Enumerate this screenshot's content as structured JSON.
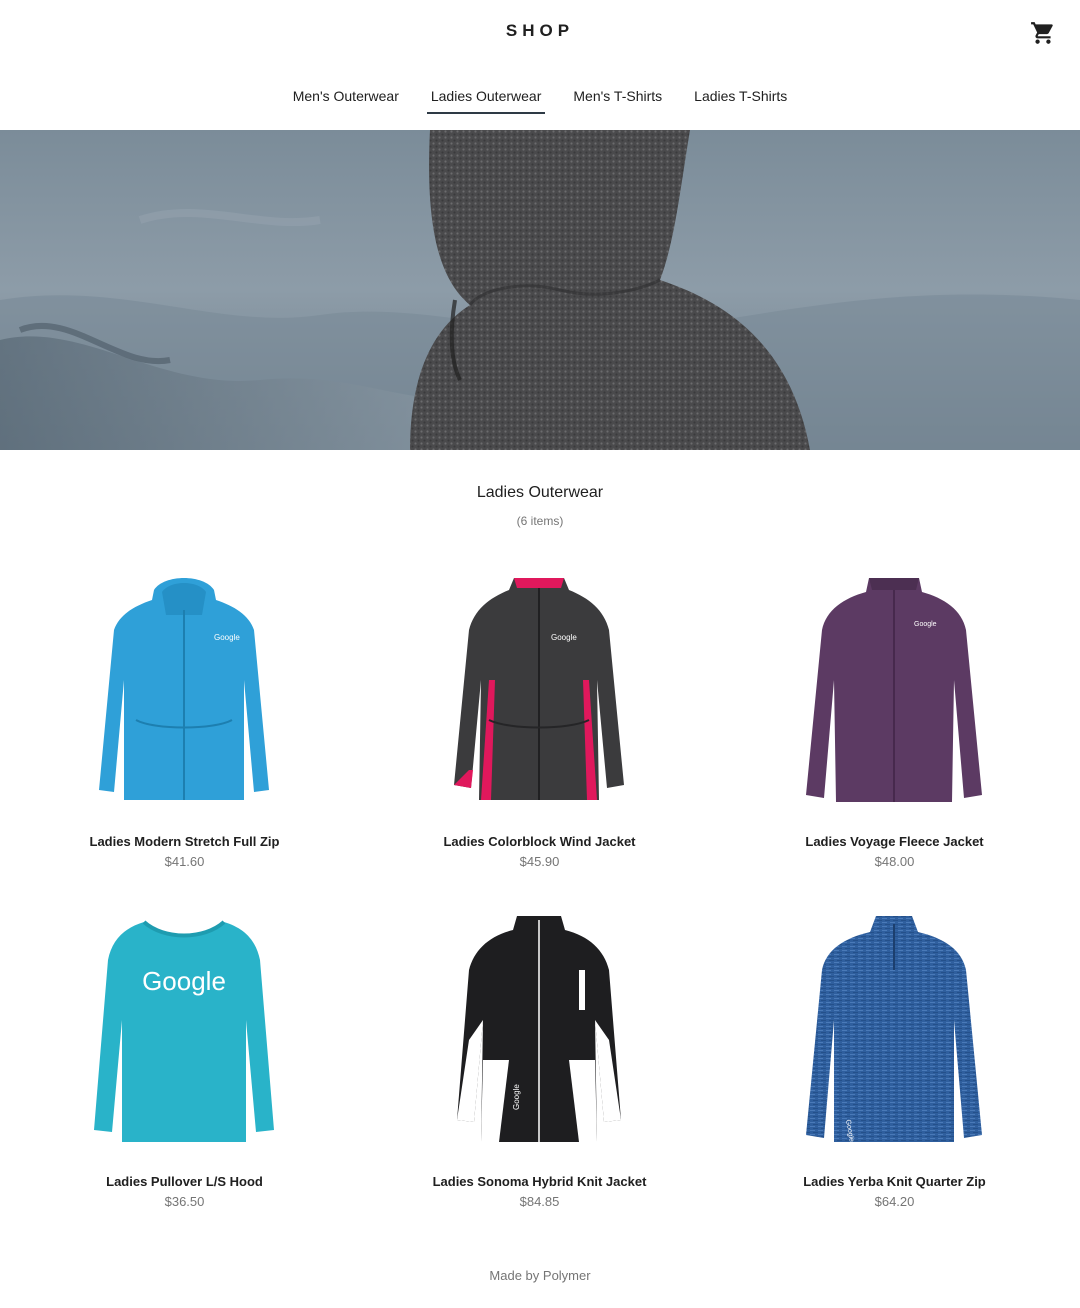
{
  "header": {
    "logo": "SHOP",
    "cart_icon": "shopping-cart-icon"
  },
  "tabs": [
    {
      "label": "Men's Outerwear",
      "active": false
    },
    {
      "label": "Ladies Outerwear",
      "active": true
    },
    {
      "label": "Men's T-Shirts",
      "active": false
    },
    {
      "label": "Ladies T-Shirts",
      "active": false
    }
  ],
  "category": {
    "title": "Ladies Outerwear",
    "count": "(6 items)"
  },
  "products": [
    {
      "name": "Ladies Modern Stretch Full Zip",
      "price": "$41.60",
      "color": "#2fa0d8",
      "style": "hoodie"
    },
    {
      "name": "Ladies Colorblock Wind Jacket",
      "price": "$45.90",
      "color": "#3b3b3d",
      "accent": "#e0185c",
      "style": "jacket"
    },
    {
      "name": "Ladies Voyage Fleece Jacket",
      "price": "$48.00",
      "color": "#5c3a63",
      "style": "fleece"
    },
    {
      "name": "Ladies Pullover L/S Hood",
      "price": "$36.50",
      "color": "#29b3c9",
      "style": "tee",
      "print": "Google"
    },
    {
      "name": "Ladies Sonoma Hybrid Knit Jacket",
      "price": "$84.85",
      "color": "#1e1e20",
      "accent": "#ffffff",
      "style": "knit"
    },
    {
      "name": "Ladies Yerba Knit Quarter Zip",
      "price": "$64.20",
      "color": "#2f5f9e",
      "style": "quarterzip"
    }
  ],
  "footer": {
    "text": "Made by Polymer"
  }
}
